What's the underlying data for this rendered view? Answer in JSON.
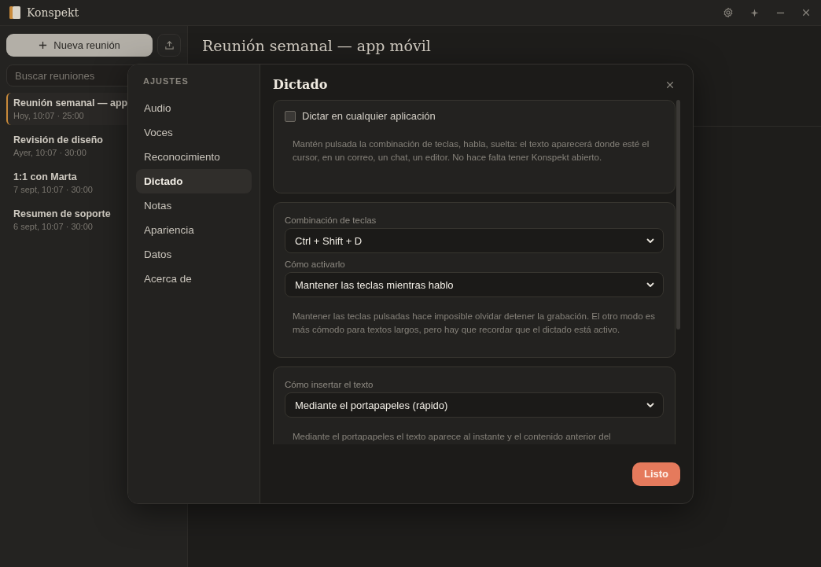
{
  "app": {
    "title": "Konspekt"
  },
  "sidebar": {
    "new_button": "Nueva reunión",
    "search": {
      "placeholder": "Buscar reuniones"
    },
    "meetings": [
      {
        "title": "Reunión semanal — app",
        "meta": "Hoy, 10:07 · 25:00",
        "selected": true
      },
      {
        "title": "Revisión de diseño",
        "meta": "Ayer, 10:07 · 30:00",
        "selected": false
      },
      {
        "title": "1:1 con Marta",
        "meta": "7 sept, 10:07 · 30:00",
        "selected": false
      },
      {
        "title": "Resumen de soporte",
        "meta": "6 sept, 10:07 · 30:00",
        "selected": false
      }
    ]
  },
  "main": {
    "title": "Reunión semanal — app móvil"
  },
  "settings": {
    "heading": "AJUSTES",
    "nav": [
      {
        "label": "Audio",
        "selected": false
      },
      {
        "label": "Voces",
        "selected": false
      },
      {
        "label": "Reconocimiento",
        "selected": false
      },
      {
        "label": "Dictado",
        "selected": true
      },
      {
        "label": "Notas",
        "selected": false
      },
      {
        "label": "Apariencia",
        "selected": false
      },
      {
        "label": "Datos",
        "selected": false
      },
      {
        "label": "Acerca de",
        "selected": false
      }
    ],
    "panel_title": "Dictado",
    "sections": [
      {
        "kind": "checkbox",
        "label": "Dictar en cualquier aplicación",
        "checked": false,
        "description": "Mantén pulsada la combinación de teclas, habla, suelta: el texto aparecerá donde esté el cursor, en un correo, un chat, un editor. No hace falta tener Konspekt abierto."
      },
      {
        "kind": "fields",
        "fields": [
          {
            "label": "Combinación de teclas",
            "value": "Ctrl + Shift + D"
          },
          {
            "label": "Cómo activarlo",
            "value": "Mantener las teclas mientras hablo"
          }
        ],
        "description": "Mantener las teclas pulsadas hace imposible olvidar detener la grabación. El otro modo es más cómodo para textos largos, pero hay que recordar que el dictado está activo."
      },
      {
        "kind": "fields",
        "fields": [
          {
            "label": "Cómo insertar el texto",
            "value": "Mediante el portapapeles (rápido)"
          }
        ],
        "description": "Mediante el portapapeles el texto aparece al instante y el contenido anterior del"
      }
    ],
    "done_button": "Listo"
  }
}
